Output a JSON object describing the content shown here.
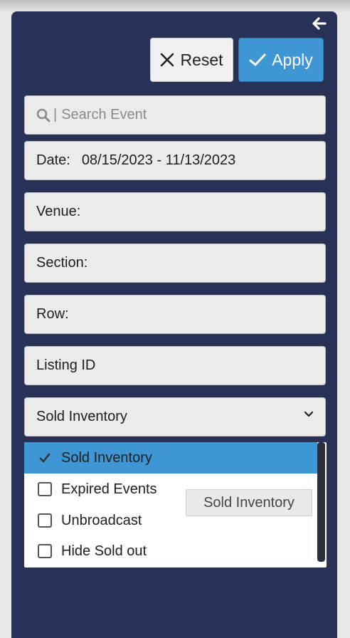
{
  "toolbar": {
    "reset_label": "Reset",
    "apply_label": "Apply"
  },
  "filters": {
    "search_prefix": "|",
    "search_placeholder": "Search Event",
    "date_label": "Date:",
    "date_value": "08/15/2023 - 11/13/2023",
    "venue_label": "Venue:",
    "section_label": "Section:",
    "row_label": "Row:",
    "listing_id_label": "Listing ID",
    "inventory_select_value": "Sold Inventory"
  },
  "dropdown": {
    "options": [
      {
        "label": "Sold Inventory",
        "checked": true
      },
      {
        "label": "Expired Events",
        "checked": false
      },
      {
        "label": "Unbroadcast",
        "checked": false
      },
      {
        "label": "Hide Sold out",
        "checked": false
      }
    ]
  },
  "tooltip": {
    "text": "Sold Inventory"
  },
  "colors": {
    "panel": "#283256",
    "accent": "#3f96d5",
    "field": "#ebebeb"
  },
  "icons": [
    "arrow-left-icon",
    "close-icon",
    "check-icon",
    "search-icon",
    "chevron-down-icon"
  ]
}
